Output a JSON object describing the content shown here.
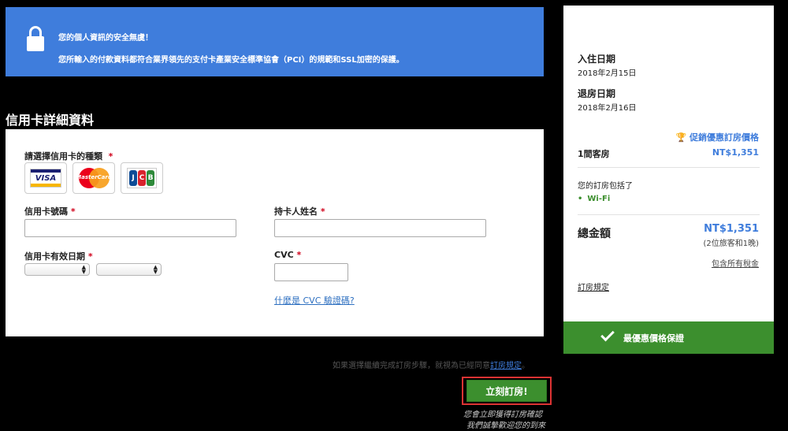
{
  "security_banner": {
    "title": "您的個人資訊的安全無虞！",
    "description": "您所輸入的付款資料都符合業界領先的支付卡產業安全標準協會（PCI）的規範和SSL加密的保護。"
  },
  "credit_card_section": {
    "title": "信用卡詳細資料",
    "card_type_label": "請選擇信用卡的種類",
    "required_mark": "*",
    "card_brands": [
      "VISA",
      "MasterCard",
      "JCB"
    ],
    "card_number_label": "信用卡號碼",
    "card_number_value": "",
    "cardholder_label": "持卡人姓名",
    "cardholder_value": "",
    "expiry_label": "信用卡有效日期",
    "expiry_month": "",
    "expiry_year": "",
    "cvc_label": "CVC",
    "cvc_value": "",
    "cvc_help_link": "什麼是 CVC 驗證碼?"
  },
  "agreement": {
    "text": "如果選擇繼續完成訂房步驟，就視為已經同意",
    "link": "訂房規定",
    "period": "。"
  },
  "book_button": {
    "label": "立刻訂房!",
    "note_line1": "您會立即獲得訂房確認",
    "note_line2": "我們誠摯歡迎您的到來"
  },
  "summary": {
    "checkin_label": "入住日期",
    "checkin_date": "2018年2月15日",
    "checkout_label": "退房日期",
    "checkout_date": "2018年2月16日",
    "promo_label": "促銷優惠訂房價格",
    "room_label": "1間客房",
    "room_price": "NT$1,351",
    "includes_label": "您的訂房包括了",
    "includes_item": "Wi-Fi",
    "total_label": "總金額",
    "total_price": "NT$1,351",
    "total_note": "(2位旅客和1晚)",
    "tax_note": "包含所有稅金",
    "policy_link": "訂房規定",
    "guarantee_label": "最優惠價格保證"
  },
  "colors": {
    "banner_blue": "#3f7ddc",
    "price_blue": "#3f7ddc",
    "guarantee_green": "#3c8f2e",
    "required_red": "#d0021b"
  },
  "icons": [
    "lock-icon",
    "trophy-icon",
    "checkmark-icon",
    "select-arrow-icon"
  ]
}
